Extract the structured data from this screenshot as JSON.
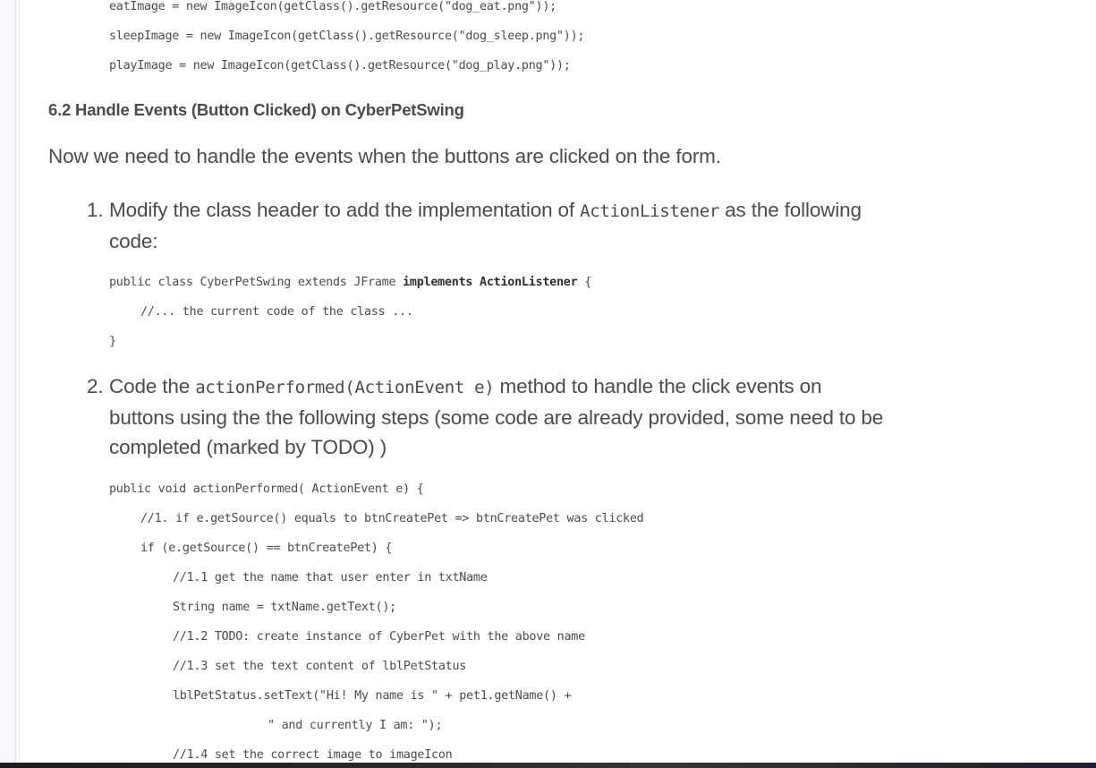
{
  "top_code_block": {
    "lines": [
      "eatImage = new ImageIcon(getClass().getResource(\"dog_eat.png\"));",
      "sleepImage = new ImageIcon(getClass().getResource(\"dog_sleep.png\"));",
      "playImage = new ImageIcon(getClass().getResource(\"dog_play.png\"));"
    ]
  },
  "section": {
    "heading": "6.2 Handle Events (Button Clicked) on CyberPetSwing",
    "intro": "Now we need to handle the events when the buttons are clicked on the form."
  },
  "steps": [
    {
      "number": "1.",
      "text_before": "Modify the class header to add the implementation of ",
      "inline_code": "ActionListener",
      "text_after": " as the following",
      "text_line2": "code:",
      "code": {
        "line1_prefix": "public class CyberPetSwing extends JFrame ",
        "line1_bold": "implements ActionListener",
        "line1_suffix": " {",
        "line2": "//... the current code of the class ...",
        "line3": "}"
      }
    },
    {
      "number": "2.",
      "text_before": "Code the ",
      "inline_code": "actionPerformed(ActionEvent e)",
      "text_after": " method to handle the click events on",
      "text_line2": "buttons using the the following steps (some code are already provided, some need to be",
      "text_line3": "completed (marked by TODO) )",
      "code_lines": [
        "public void actionPerformed( ActionEvent e) {",
        "//1. if e.getSource() equals to btnCreatePet => btnCreatePet was clicked",
        "if (e.getSource() == btnCreatePet) {",
        "//1.1 get the name that user enter in txtName",
        "String name = txtName.getText();",
        "//1.2 TODO: create instance of CyberPet with the above name",
        "//1.3 set the text content of lblPetStatus",
        "lblPetStatus.setText(\"Hi! My name is \" + pet1.getName() +",
        "\" and currently I am: \");",
        "//1.4 set the correct image to imageIcon"
      ]
    }
  ]
}
